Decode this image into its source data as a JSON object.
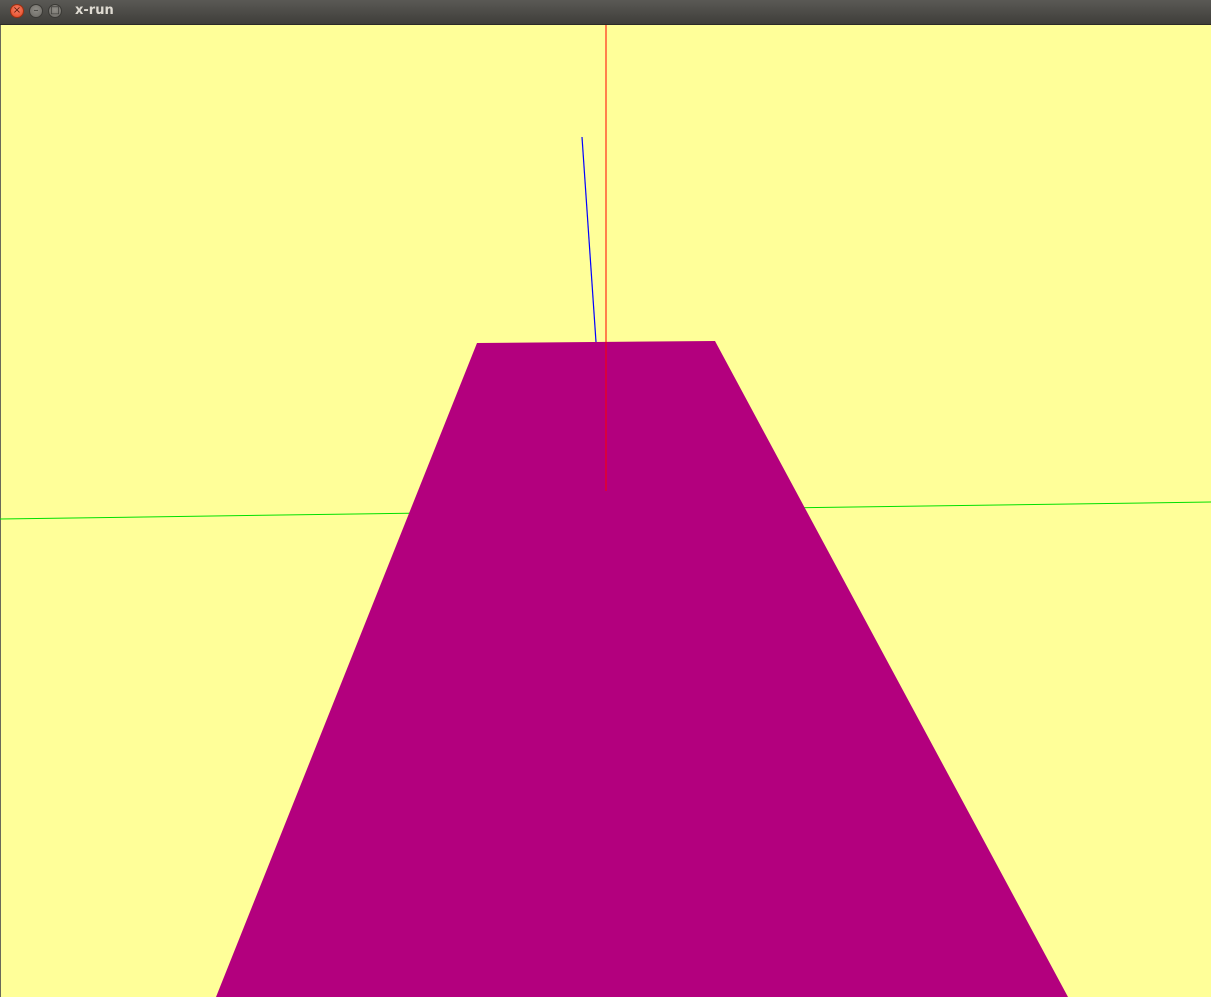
{
  "window": {
    "title": "x-run",
    "close_glyph": "×",
    "minimize_glyph": "–",
    "maximize_glyph": "□"
  },
  "scene": {
    "background_color": "#ffff99",
    "ground_color": "#b3007e",
    "x_axis_color": "#00e000",
    "y_axis_color": "#ff0000",
    "z_axis_color": "#0000ff"
  }
}
